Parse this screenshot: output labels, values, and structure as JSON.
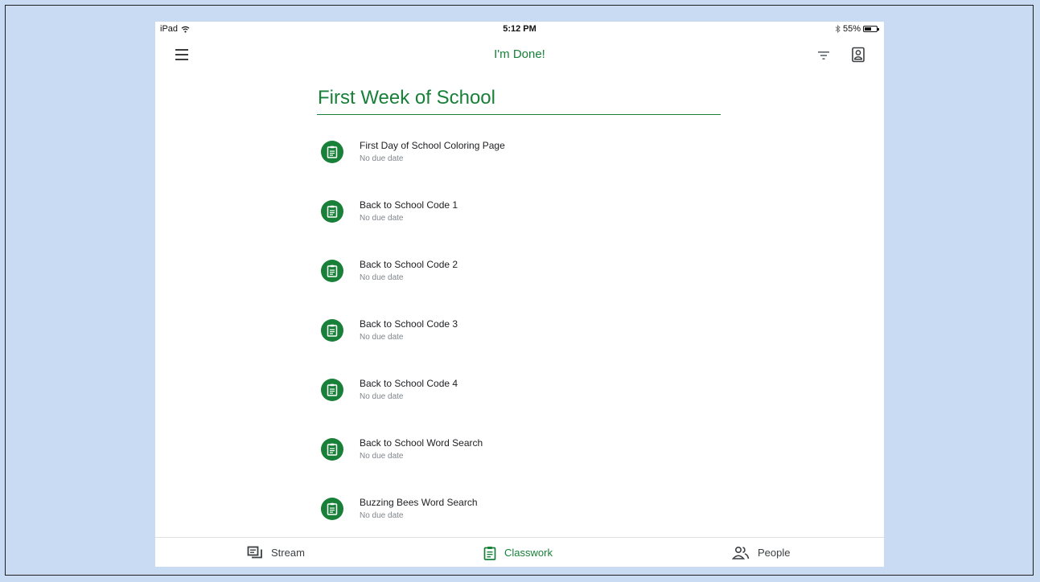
{
  "status_bar": {
    "device": "iPad",
    "time": "5:12 PM",
    "battery": "55%",
    "battery_level": 0.55
  },
  "app_bar": {
    "title": "I'm Done!"
  },
  "topic": {
    "title": "First Week of School"
  },
  "assignments": [
    {
      "title": "First Day of School Coloring Page",
      "due": "No due date"
    },
    {
      "title": "Back to School Code 1",
      "due": "No due date"
    },
    {
      "title": "Back to School Code 2",
      "due": "No due date"
    },
    {
      "title": "Back to School Code 3",
      "due": "No due date"
    },
    {
      "title": "Back to School Code 4",
      "due": "No due date"
    },
    {
      "title": "Back to School Word Search",
      "due": "No due date"
    },
    {
      "title": "Buzzing Bees Word Search",
      "due": "No due date"
    }
  ],
  "bottom_nav": [
    {
      "label": "Stream",
      "icon": "stream-icon"
    },
    {
      "label": "Classwork",
      "icon": "classwork-icon",
      "active": true
    },
    {
      "label": "People",
      "icon": "people-icon"
    }
  ],
  "colors": {
    "brand_green": "#188038",
    "annotation_arrow": "#ff0000",
    "background": "#c9daf3"
  }
}
